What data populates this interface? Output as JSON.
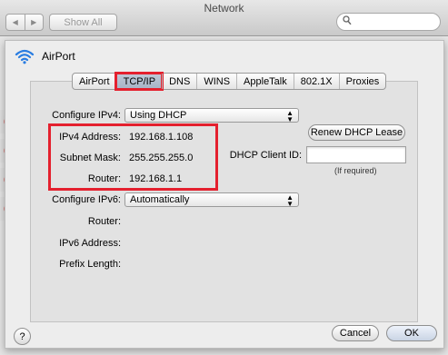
{
  "window": {
    "title": "Network"
  },
  "toolbar": {
    "back_icon": "◀",
    "forward_icon": "▶",
    "show_all_label": "Show All",
    "search_placeholder": "",
    "search_glyph": "🔍"
  },
  "sheet": {
    "interface_name": "AirPort",
    "tabs": [
      {
        "label": "AirPort"
      },
      {
        "label": "TCP/IP",
        "active": true
      },
      {
        "label": "DNS"
      },
      {
        "label": "WINS"
      },
      {
        "label": "AppleTalk"
      },
      {
        "label": "802.1X"
      },
      {
        "label": "Proxies"
      }
    ],
    "configure_ipv4_label": "Configure IPv4:",
    "configure_ipv4_value": "Using DHCP",
    "ipv4_address_label": "IPv4 Address:",
    "ipv4_address_value": "192.168.1.108",
    "subnet_mask_label": "Subnet Mask:",
    "subnet_mask_value": "255.255.255.0",
    "router_label": "Router:",
    "router_value": "192.168.1.1",
    "renew_lease_label": "Renew DHCP Lease",
    "dhcp_client_id_label": "DHCP Client ID:",
    "dhcp_client_id_value": "",
    "dhcp_client_id_hint": "(If required)",
    "configure_ipv6_label": "Configure IPv6:",
    "configure_ipv6_value": "Automatically",
    "ipv6_router_label": "Router:",
    "ipv6_address_label": "IPv6 Address:",
    "prefix_length_label": "Prefix Length:",
    "help_label": "?",
    "cancel_label": "Cancel",
    "ok_label": "OK"
  },
  "colors": {
    "highlight": "#e4202e",
    "accent": "#a6b4c7"
  }
}
